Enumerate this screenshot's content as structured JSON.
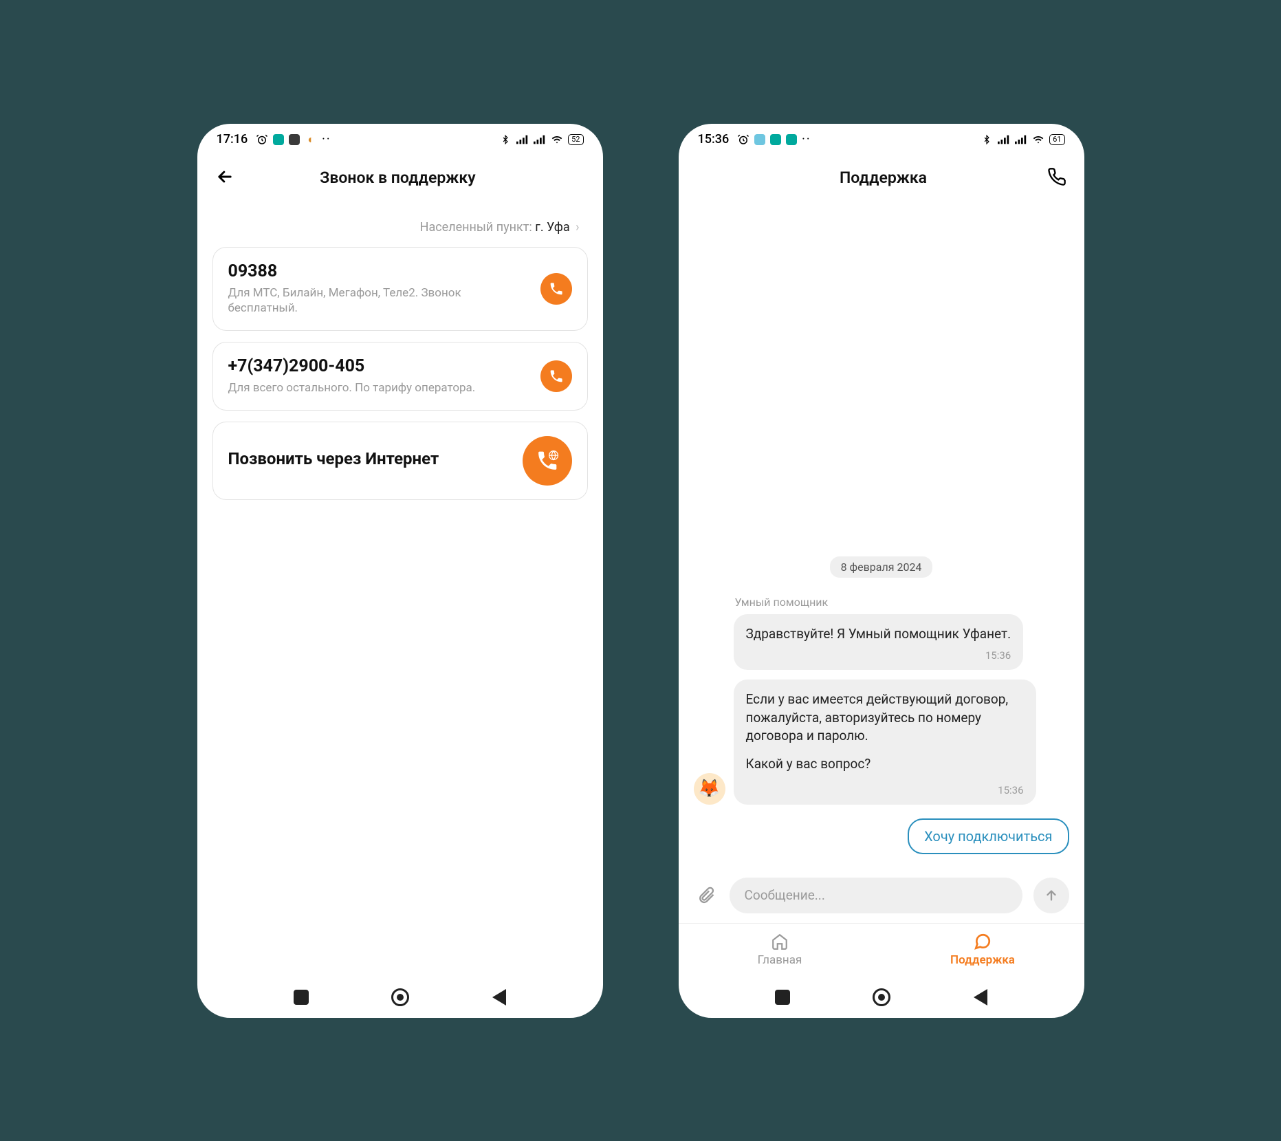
{
  "screen1": {
    "status": {
      "time": "17:16",
      "battery": "52"
    },
    "header": {
      "title": "Звонок в поддержку"
    },
    "location": {
      "label": "Населенный пункт:",
      "city": "г. Уфа"
    },
    "cards": [
      {
        "title": "09388",
        "sub": "Для МТС, Билайн, Мегафон, Теле2. Звонок бесплатный."
      },
      {
        "title": "+7(347)2900-405",
        "sub": "Для всего остального. По тарифу оператора."
      },
      {
        "title": "Позвонить через Интернет",
        "sub": ""
      }
    ]
  },
  "screen2": {
    "status": {
      "time": "15:36",
      "battery": "61"
    },
    "header": {
      "title": "Поддержка"
    },
    "chat": {
      "date": "8 февраля 2024",
      "sender": "Умный помощник",
      "messages": [
        {
          "text": "Здравствуйте! Я Умный помощник Уфанет.",
          "time": "15:36"
        },
        {
          "text": "Если у вас имеется действующий договор, пожалуйста, авторизуйтесь по номеру договора и паролю.",
          "text2": "Какой у вас вопрос?",
          "time": "15:36"
        }
      ],
      "suggestion": "Хочу подключиться"
    },
    "input": {
      "placeholder": "Сообщение..."
    },
    "tabs": {
      "home": "Главная",
      "support": "Поддержка"
    }
  }
}
